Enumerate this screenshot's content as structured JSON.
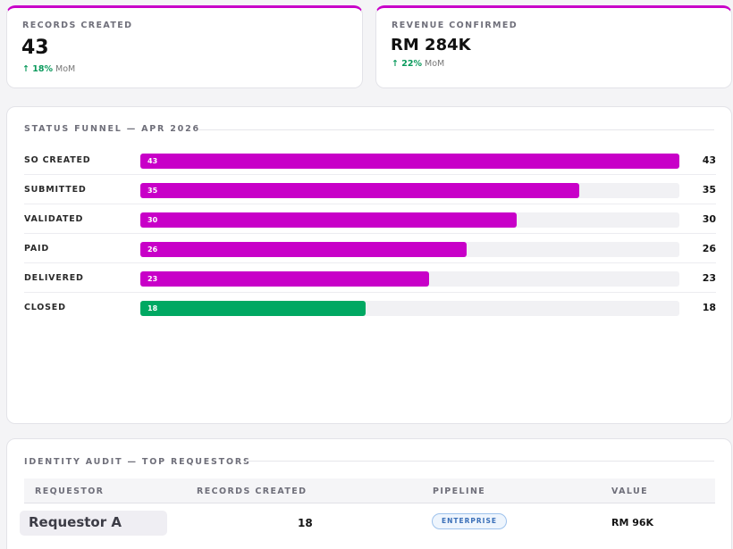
{
  "kpis": [
    {
      "label": "RECORDS CREATED",
      "value": "43",
      "delta": "↑ 18%",
      "delta_suffix": "MoM"
    },
    {
      "label": "REVENUE CONFIRMED",
      "value": "RM 284K",
      "delta": "↑ 22%",
      "delta_suffix": "MoM"
    }
  ],
  "funnel": {
    "title": "STATUS FUNNEL — APR 2026",
    "max": 43,
    "stages": [
      {
        "label": "SO CREATED",
        "value": 43,
        "display": "43",
        "color": "#c800c8"
      },
      {
        "label": "SUBMITTED",
        "value": 35,
        "display": "35",
        "color": "#c800c8"
      },
      {
        "label": "VALIDATED",
        "value": 30,
        "display": "30",
        "color": "#c800c8"
      },
      {
        "label": "PAID",
        "value": 26,
        "display": "26",
        "color": "#c800c8"
      },
      {
        "label": "DELIVERED",
        "value": 23,
        "display": "23",
        "color": "#c800c8"
      },
      {
        "label": "CLOSED",
        "value": 18,
        "display": "18",
        "color": "#00a862"
      }
    ]
  },
  "audit": {
    "title": "IDENTITY AUDIT — TOP REQUESTORS",
    "columns": [
      "REQUESTOR",
      "RECORDS CREATED",
      "PIPELINE",
      "VALUE"
    ],
    "rows": [
      {
        "requestor": "Requestor A",
        "records": "18",
        "pipeline": "ENTERPRISE",
        "value": "RM 96K"
      }
    ]
  },
  "colors": {
    "accent": "#c800c8",
    "success": "#00a862",
    "pill": "#3a6fb8"
  }
}
